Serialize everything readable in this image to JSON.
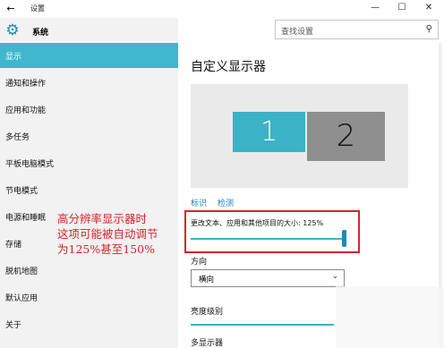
{
  "window": {
    "back_icon": "back-arrow-icon",
    "title": "设置",
    "minimize": "—",
    "maximize": "☐",
    "close": "✕"
  },
  "sidebar": {
    "header_icon": "gear-icon",
    "header_label": "系统",
    "items": [
      {
        "label": "显示",
        "active": true
      },
      {
        "label": "通知和操作"
      },
      {
        "label": "应用和功能"
      },
      {
        "label": "多任务"
      },
      {
        "label": "平板电脑模式"
      },
      {
        "label": "节电模式"
      },
      {
        "label": "电源和睡眠"
      },
      {
        "label": "存储"
      },
      {
        "label": "脱机地图"
      },
      {
        "label": "默认应用"
      },
      {
        "label": "关于"
      }
    ]
  },
  "search": {
    "placeholder": "查找设置",
    "icon": "search-icon"
  },
  "main": {
    "title": "自定义显示器",
    "monitors": [
      "1",
      "2"
    ],
    "links": [
      "标识",
      "检测"
    ],
    "scale_label": "更改文本、应用和其他项目的大小: 125%",
    "scale_value_percent": 125,
    "orientation_label": "方向",
    "orientation_value": "横向",
    "brightness_label": "亮度级别",
    "multi_display_label": "多显示器"
  },
  "annotation": {
    "lines": [
      "高分辨率显示器时",
      "这项可能被自动调节",
      "为125%甚至150%"
    ],
    "color": "#d3252b"
  },
  "colors": {
    "accent": "#3fb7cc",
    "link": "#1a7fc1"
  }
}
